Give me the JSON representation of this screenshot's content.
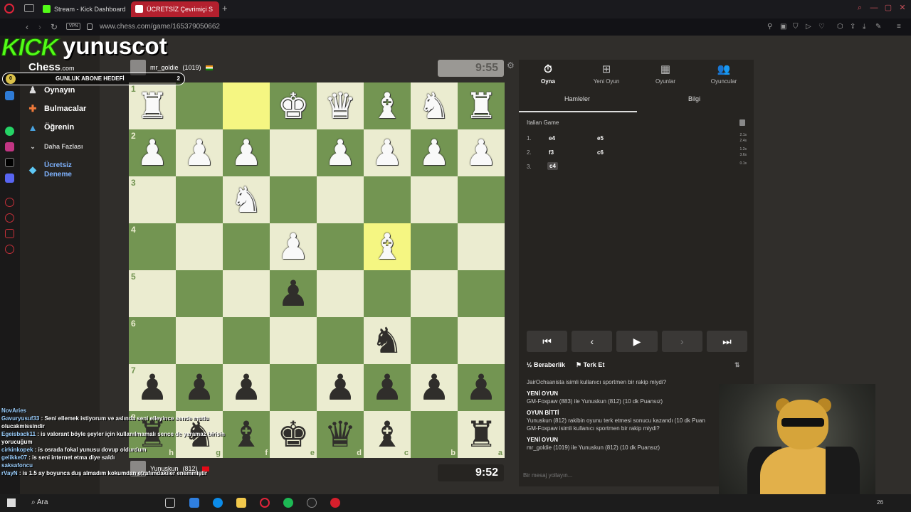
{
  "browser": {
    "tabs": [
      {
        "label": "Stream - Kick Dashboard",
        "active": false
      },
      {
        "label": "ÜCRETSİZ Çevrimiçi S",
        "active": true
      }
    ],
    "vpn_label": "VPN",
    "url": "www.chess.com/game/165379050662"
  },
  "overlay": {
    "kick_logo": "KICK",
    "streamer": "yunuscot",
    "goal_label": "GUNLUK ABONE HEDEFİ",
    "goal_value": "2",
    "goal_start": "0"
  },
  "sidebar": {
    "logo": "Chess",
    "logo_suffix": ".com",
    "items": [
      {
        "label": "Oynayın",
        "icon": "pawn-icon"
      },
      {
        "label": "Bulmacalar",
        "icon": "puzzle-icon"
      },
      {
        "label": "Öğrenin",
        "icon": "graduation-cap-icon"
      },
      {
        "label": "Daha Fazlası",
        "icon": "chevron-down-icon"
      },
      {
        "label": "Ücretsiz Deneme",
        "icon": "diamond-icon"
      }
    ]
  },
  "game": {
    "top_player": {
      "name": "mr_goldie",
      "rating": "(1019)",
      "clock": "9:55"
    },
    "bottom_player": {
      "name": "Yunuskun",
      "rating": "(812)",
      "clock": "9:52"
    },
    "board": [
      [
        "wR",
        "",
        "",
        "wK",
        "wQ",
        "wB",
        "wN",
        "wR"
      ],
      [
        "wP",
        "wP",
        "wP",
        "",
        "wP",
        "wP",
        "wP",
        "wP"
      ],
      [
        "",
        "",
        "wN",
        "",
        "",
        "",
        "",
        ""
      ],
      [
        "",
        "",
        "",
        "wP",
        "",
        "wB",
        "",
        ""
      ],
      [
        "",
        "",
        "",
        "bP",
        "",
        "",
        "",
        ""
      ],
      [
        "",
        "",
        "",
        "",
        "",
        "bN",
        "",
        ""
      ],
      [
        "bP",
        "bP",
        "bP",
        "",
        "bP",
        "bP",
        "bP",
        "bP"
      ],
      [
        "bR",
        "bN",
        "bB",
        "bK",
        "bQ",
        "bB",
        "",
        "bR"
      ]
    ],
    "highlighted": [
      [
        0,
        2
      ],
      [
        3,
        5
      ]
    ],
    "rank_labels": [
      "1",
      "2",
      "3",
      "4",
      "5",
      "6",
      "7",
      "8"
    ],
    "file_labels": [
      "h",
      "g",
      "f",
      "e",
      "d",
      "c",
      "b",
      "a"
    ]
  },
  "panel": {
    "tabs": [
      {
        "label": "Oyna",
        "icon": "stopwatch-icon"
      },
      {
        "label": "Yeni Oyun",
        "icon": "plus-icon"
      },
      {
        "label": "Oyunlar",
        "icon": "board-icon"
      },
      {
        "label": "Oyuncular",
        "icon": "players-icon"
      }
    ],
    "subtabs": [
      "Hamleler",
      "Bilgi"
    ],
    "opening": "Italian Game",
    "moves": [
      {
        "num": "1.",
        "white": "e4",
        "black": "e5",
        "times": [
          "2.1s",
          "2.4s"
        ]
      },
      {
        "num": "2.",
        "white": "f3",
        "black": "c6",
        "times": [
          "1.2s",
          "3.6s"
        ]
      },
      {
        "num": "3.",
        "white": "c4",
        "black": "",
        "times": [
          "0.1s"
        ]
      }
    ],
    "draw_label": "Beraberlik",
    "resign_label": "Terk Et",
    "chat": [
      {
        "type": "text",
        "text": "JairOchsanista isimli kullanıcı sportmen bir rakip miydi?"
      },
      {
        "type": "head",
        "text": "YENİ OYUN"
      },
      {
        "type": "text",
        "text": "GM-Foxpaw (883) ile Yunuskun (812) (10 dk Puansız)"
      },
      {
        "type": "head",
        "text": "OYUN BİTTİ"
      },
      {
        "type": "text",
        "text": "Yunuskun (812) rakibin oyunu terk etmesi sonucu kazandı (10 dk Puan"
      },
      {
        "type": "text",
        "text": "GM-Foxpaw isimli kullanıcı sportmen bir rakip miydi?"
      },
      {
        "type": "head",
        "text": "YENİ OYUN"
      },
      {
        "type": "text",
        "text": "mr_goldie (1019) ile Yunuskun (812) (10 dk Puansız)"
      }
    ],
    "chat_placeholder": "Bir mesaj yollayın..."
  },
  "stream_chat": [
    {
      "name": "NovAries",
      "msg": ""
    },
    {
      "name": "Gavuryusuf33",
      "msg": "Seni ellemek istiyorum ve aslında seni elleyince sende mutlu olucakmissindir"
    },
    {
      "name": "Egeisback11",
      "msg": "is valorant böyle şeyler için kullanılmamalı sence de yaramaz birisin yorucuğum"
    },
    {
      "name": "cirkinkopek",
      "msg": "is osrada fokal yunusu dovup oldurdum"
    },
    {
      "name": "gelikke07",
      "msg": "is seni internet etma diye saldı"
    },
    {
      "name": "saksafoncu",
      "msg": ""
    },
    {
      "name": "rVayN",
      "msg": "is 1.5 ay boyunca duş almadım kokumdan etrafımdakiler enemmiştir"
    }
  ],
  "taskbar": {
    "search": "Ara"
  }
}
